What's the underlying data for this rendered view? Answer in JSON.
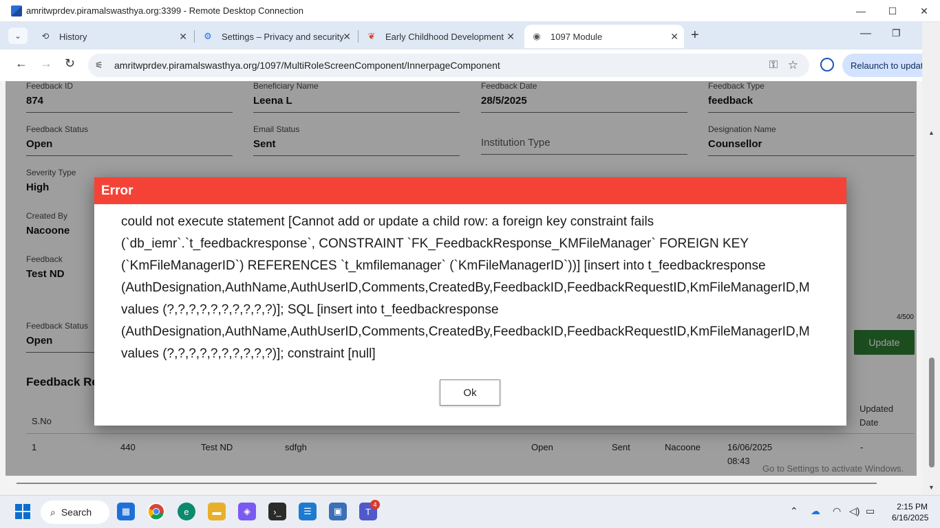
{
  "rdp": {
    "title": "amritwprdev.piramalswasthya.org:3399 - Remote Desktop Connection"
  },
  "tabs": [
    {
      "label": "History"
    },
    {
      "label": "Settings – Privacy and security"
    },
    {
      "label": "Early Childhood Development"
    },
    {
      "label": "1097 Module"
    }
  ],
  "url": "amritwprdev.piramalswasthya.org/1097/MultiRoleScreenComponent/InnerpageComponent",
  "relaunch_label": "Relaunch to updat",
  "form": {
    "feedback_id": {
      "label": "Feedback ID",
      "value": "874"
    },
    "beneficiary_name": {
      "label": "Beneficiary Name",
      "value": "Leena L"
    },
    "feedback_date": {
      "label": "Feedback Date",
      "value": "28/5/2025"
    },
    "feedback_type": {
      "label": "Feedback Type",
      "value": "feedback"
    },
    "feedback_status": {
      "label": "Feedback Status",
      "value": "Open"
    },
    "email_status": {
      "label": "Email Status",
      "value": "Sent"
    },
    "institution_type": {
      "placeholder": "Institution Type"
    },
    "designation_name": {
      "label": "Designation Name",
      "value": "Counsellor"
    },
    "severity_type": {
      "label": "Severity Type",
      "value": "High"
    },
    "created_by": {
      "label": "Created By",
      "value": "Nacoone"
    },
    "feedback": {
      "label": "Feedback",
      "value": "Test ND"
    },
    "char_count": "4/500",
    "status2": {
      "label": "Feedback Status",
      "value": "Open"
    },
    "update_label": "Update"
  },
  "section_title": "Feedback Re",
  "table": {
    "headers": {
      "sno": "S.No",
      "updated_date": "Updated\nDate"
    },
    "row": {
      "sno": "1",
      "id": "440",
      "name": "Test ND",
      "comments": "sdfgh",
      "status": "Open",
      "email": "Sent",
      "created_by": "Nacoone",
      "date": "16/06/2025",
      "time": "08:43",
      "updated": "-"
    }
  },
  "watermark": "Go to Settings to activate Windows.",
  "modal": {
    "title": "Error",
    "lines": [
      "could not execute statement [Cannot add or update a child row: a foreign key constraint fails",
      "(`db_iemr`.`t_feedbackresponse`, CONSTRAINT `FK_FeedbackResponse_KMFileManager` FOREIGN KEY",
      "(`KmFileManagerID`) REFERENCES `t_kmfilemanager` (`KmFileManagerID`))] [insert into t_feedbackresponse",
      "(AuthDesignation,AuthName,AuthUserID,Comments,CreatedBy,FeedbackID,FeedbackRequestID,KmFileManagerID,M",
      "values (?,?,?,?,?,?,?,?,?,?)]; SQL [insert into t_feedbackresponse",
      "(AuthDesignation,AuthName,AuthUserID,Comments,CreatedBy,FeedbackID,FeedbackRequestID,KmFileManagerID,M",
      "values (?,?,?,?,?,?,?,?,?,?)]; constraint [null]"
    ],
    "ok_label": "Ok"
  },
  "taskbar": {
    "search_label": "Search",
    "teams_badge": "4",
    "time": "2:15 PM",
    "date": "6/16/2025"
  },
  "colors": {
    "error_header": "#f44336",
    "update_button": "#2e7d32",
    "chrome_frame": "#dfe8f5"
  }
}
